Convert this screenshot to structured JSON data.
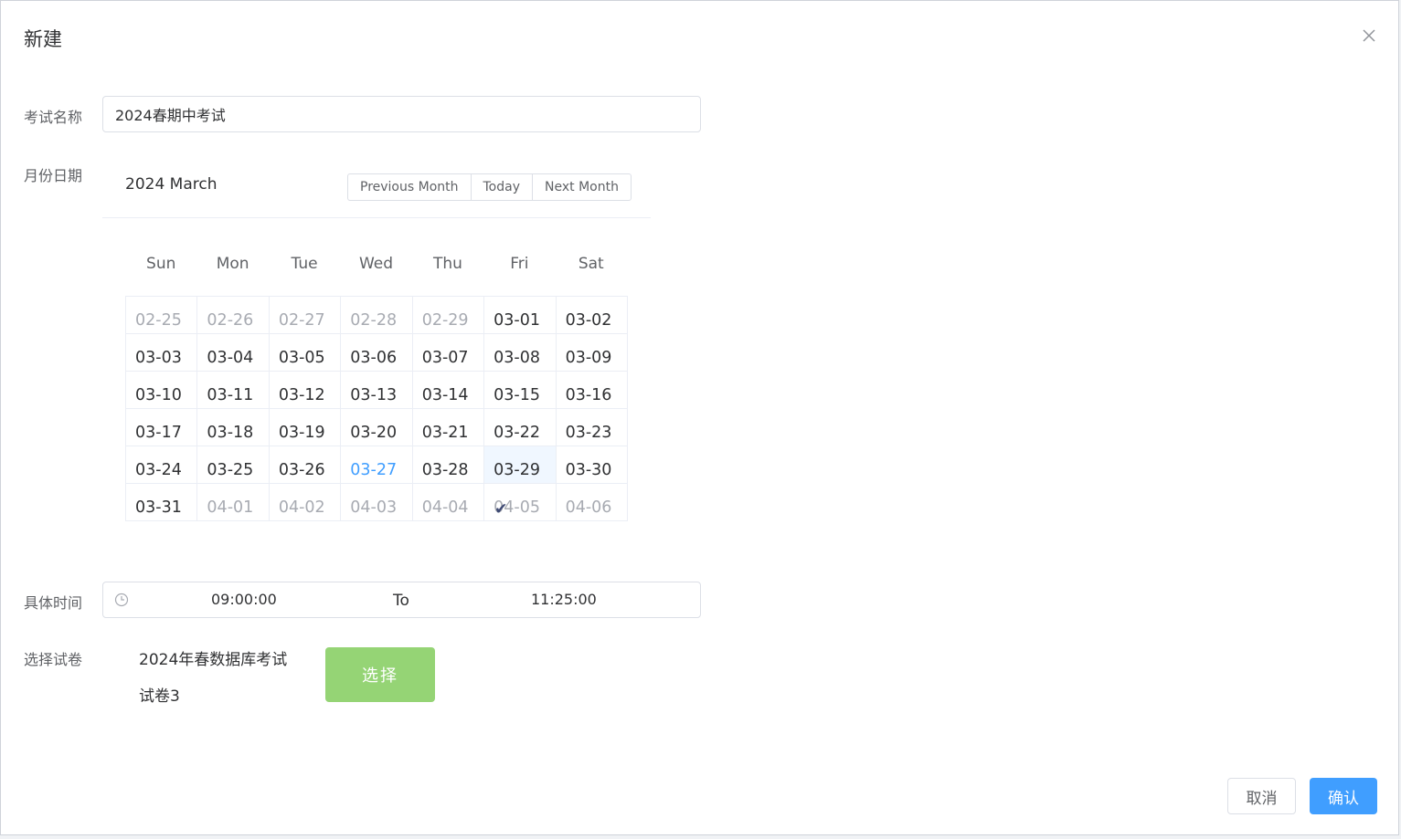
{
  "dialog": {
    "title": "新建",
    "close_icon": "close-icon"
  },
  "form": {
    "exam_name_label": "考试名称",
    "exam_name_value": "2024春期中考试",
    "date_label": "月份日期",
    "time_label": "具体时间",
    "paper_label": "选择试卷"
  },
  "calendar": {
    "title": "2024 March",
    "buttons": {
      "prev": "Previous Month",
      "today": "Today",
      "next": "Next Month"
    },
    "weekdays": [
      "Sun",
      "Mon",
      "Tue",
      "Wed",
      "Thu",
      "Fri",
      "Sat"
    ],
    "days": [
      {
        "label": "02-25",
        "type": "other"
      },
      {
        "label": "02-26",
        "type": "other"
      },
      {
        "label": "02-27",
        "type": "other"
      },
      {
        "label": "02-28",
        "type": "other"
      },
      {
        "label": "02-29",
        "type": "other"
      },
      {
        "label": "03-01",
        "type": "current"
      },
      {
        "label": "03-02",
        "type": "current"
      },
      {
        "label": "03-03",
        "type": "current"
      },
      {
        "label": "03-04",
        "type": "current"
      },
      {
        "label": "03-05",
        "type": "current"
      },
      {
        "label": "03-06",
        "type": "current"
      },
      {
        "label": "03-07",
        "type": "current"
      },
      {
        "label": "03-08",
        "type": "current"
      },
      {
        "label": "03-09",
        "type": "current"
      },
      {
        "label": "03-10",
        "type": "current"
      },
      {
        "label": "03-11",
        "type": "current"
      },
      {
        "label": "03-12",
        "type": "current"
      },
      {
        "label": "03-13",
        "type": "current"
      },
      {
        "label": "03-14",
        "type": "current"
      },
      {
        "label": "03-15",
        "type": "current"
      },
      {
        "label": "03-16",
        "type": "current"
      },
      {
        "label": "03-17",
        "type": "current"
      },
      {
        "label": "03-18",
        "type": "current"
      },
      {
        "label": "03-19",
        "type": "current"
      },
      {
        "label": "03-20",
        "type": "current"
      },
      {
        "label": "03-21",
        "type": "current"
      },
      {
        "label": "03-22",
        "type": "current"
      },
      {
        "label": "03-23",
        "type": "current"
      },
      {
        "label": "03-24",
        "type": "current"
      },
      {
        "label": "03-25",
        "type": "current"
      },
      {
        "label": "03-26",
        "type": "current"
      },
      {
        "label": "03-27",
        "type": "today"
      },
      {
        "label": "03-28",
        "type": "current"
      },
      {
        "label": "03-29",
        "type": "selected"
      },
      {
        "label": "03-30",
        "type": "current"
      },
      {
        "label": "03-31",
        "type": "current"
      },
      {
        "label": "04-01",
        "type": "other"
      },
      {
        "label": "04-02",
        "type": "other"
      },
      {
        "label": "04-03",
        "type": "other"
      },
      {
        "label": "04-04",
        "type": "other"
      },
      {
        "label": "04-05",
        "type": "other-checked",
        "mark": "✔"
      },
      {
        "label": "04-06",
        "type": "other"
      }
    ]
  },
  "time_range": {
    "clock_icon": "clock-icon",
    "start": "09:00:00",
    "separator": "To",
    "end": "11:25:00"
  },
  "paper": {
    "name": "2024年春数据库考试",
    "sub": "试卷3",
    "select_button": "选择"
  },
  "footer": {
    "cancel": "取消",
    "confirm": "确认"
  },
  "colors": {
    "primary": "#409eff",
    "success_light": "#95d475",
    "text_primary": "#303133",
    "text_regular": "#606266",
    "text_placeholder": "#a8abb2"
  }
}
